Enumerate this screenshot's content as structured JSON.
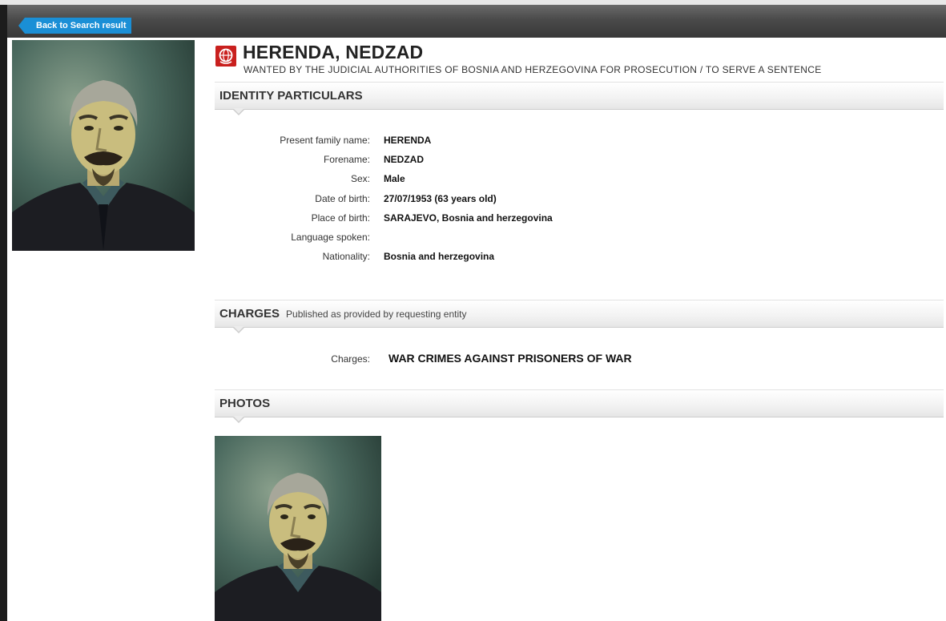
{
  "nav": {
    "back_label": "Back to Search result"
  },
  "notice": {
    "name": "HERENDA, NEDZAD",
    "subtitle": "WANTED BY THE JUDICIAL AUTHORITIES OF BOSNIA AND HERZEGOVINA FOR PROSECUTION / TO SERVE A SENTENCE"
  },
  "identity": {
    "title": "IDENTITY PARTICULARS",
    "fields": [
      {
        "label": "Present family name:",
        "value": "HERENDA"
      },
      {
        "label": "Forename:",
        "value": "NEDZAD"
      },
      {
        "label": "Sex:",
        "value": "Male"
      },
      {
        "label": "Date of birth:",
        "value": "27/07/1953 (63 years old)"
      },
      {
        "label": "Place of birth:",
        "value": "SARAJEVO, Bosnia and herzegovina"
      },
      {
        "label": "Language spoken:",
        "value": ""
      },
      {
        "label": "Nationality:",
        "value": "Bosnia and herzegovina"
      }
    ]
  },
  "charges": {
    "title": "CHARGES",
    "note": "Published as provided by requesting entity",
    "label": "Charges:",
    "value": "WAR CRIMES AGAINST PRISONERS OF WAR"
  },
  "photos": {
    "title": "PHOTOS"
  },
  "colors": {
    "accent_blue": "#1a8fd6",
    "notice_red": "#c9201e",
    "topbar_dark": "#3a3a3a"
  },
  "icons": {
    "notice": "red-notice-icon",
    "back": "chevron-left-icon"
  }
}
